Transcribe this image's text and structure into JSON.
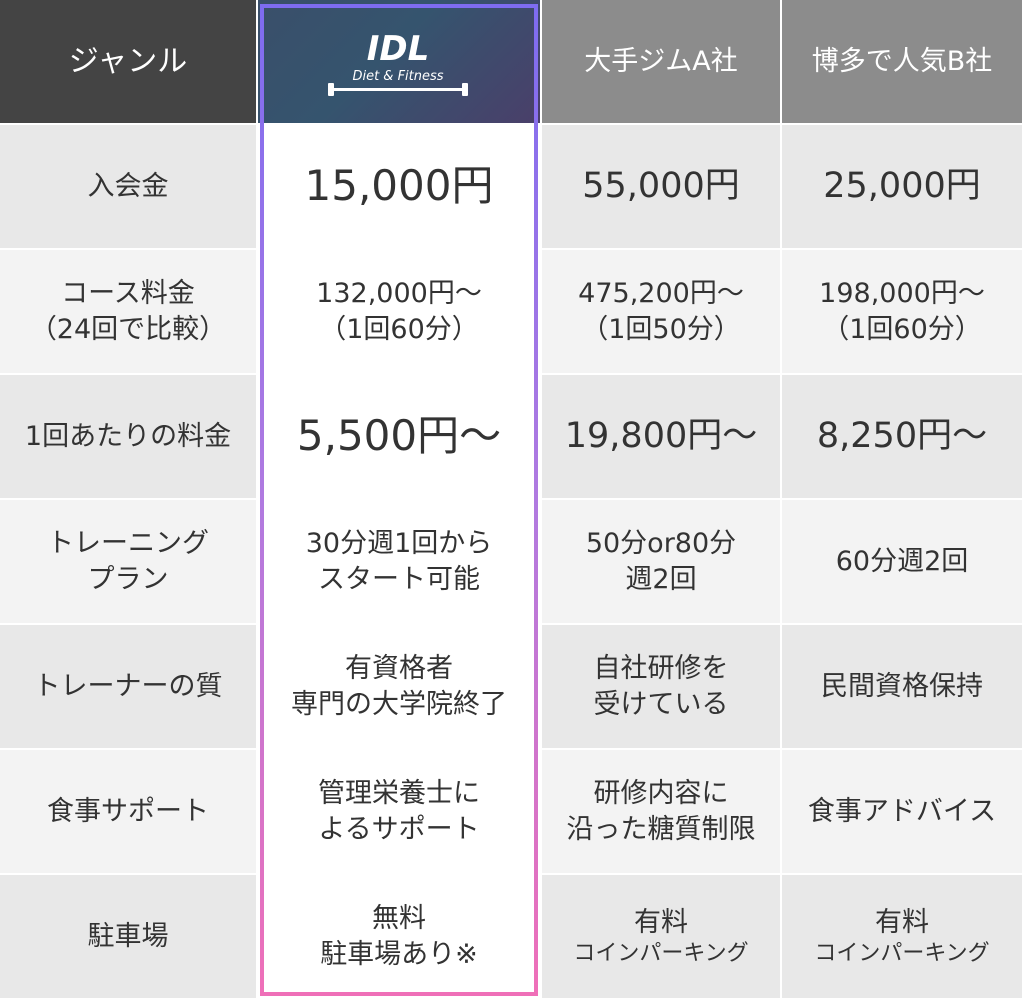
{
  "header": {
    "genre": "ジャンル",
    "logo_text": "IDL",
    "logo_sub": "Diet & Fitness",
    "company_a": "大手ジムA社",
    "company_b": "博多で人気B社"
  },
  "rows": [
    {
      "label": "入会金",
      "idl": "15,000円",
      "a": "55,000円",
      "b": "25,000円"
    },
    {
      "label": "コース料金\n（24回で比較）",
      "idl": "132,000円～\n（1回60分）",
      "a": "475,200円～\n（1回50分）",
      "b": "198,000円～\n（1回60分）"
    },
    {
      "label": "1回あたりの料金",
      "idl": "5,500円～",
      "a": "19,800円～",
      "b": "8,250円～"
    },
    {
      "label": "トレーニング\nプラン",
      "idl": "30分週1回から\nスタート可能",
      "a": "50分or80分\n週2回",
      "b": "60分週2回"
    },
    {
      "label": "トレーナーの質",
      "idl": "有資格者\n専門の大学院終了",
      "a": "自社研修を\n受けている",
      "b": "民間資格保持"
    },
    {
      "label": "食事サポート",
      "idl": "管理栄養士に\nよるサポート",
      "a": "研修内容に\n沿った糖質制限",
      "b": "食事アドバイス"
    },
    {
      "label": "駐車場",
      "idl": "無料\n駐車場あり※",
      "a_line1": "有料",
      "a_line2": "コインパーキング",
      "b_line1": "有料",
      "b_line2": "コインパーキング"
    }
  ]
}
